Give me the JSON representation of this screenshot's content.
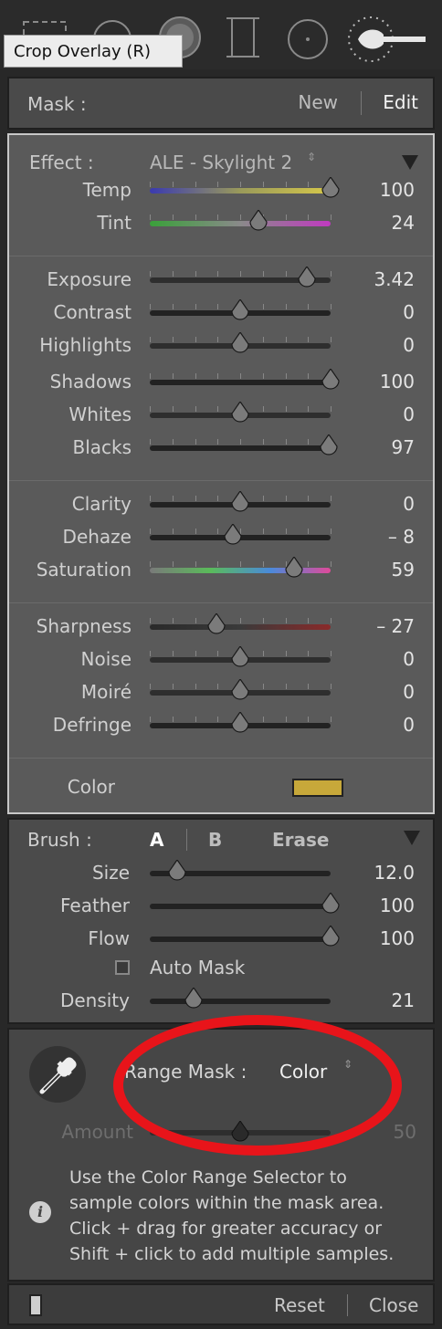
{
  "toolbar": {
    "tools": [
      "crop-overlay-icon",
      "spot-removal-icon",
      "red-eye-icon",
      "graduated-filter-icon",
      "radial-filter-icon",
      "adjustment-brush-icon"
    ],
    "tooltip": "Crop Overlay (R)"
  },
  "mask": {
    "label": "Mask :",
    "new_label": "New",
    "edit_label": "Edit"
  },
  "effect": {
    "label": "Effect :",
    "preset": "ALE - Skylight 2",
    "updown": "⇕"
  },
  "sliders": [
    {
      "label": "Temp",
      "value": "100",
      "pos": 1.0,
      "track": "temp"
    },
    {
      "label": "Tint",
      "value": "24",
      "pos": 0.6,
      "track": "tint"
    },
    {
      "label": "Exposure",
      "value": "3.42",
      "pos": 0.87,
      "track": "gray"
    },
    {
      "label": "Contrast",
      "value": "0",
      "pos": 0.5,
      "track": "dark"
    },
    {
      "label": "Highlights",
      "value": "0",
      "pos": 0.5,
      "track": "gray"
    },
    {
      "label": "Shadows",
      "value": "100",
      "pos": 1.0,
      "track": "dark"
    },
    {
      "label": "Whites",
      "value": "0",
      "pos": 0.5,
      "track": "gray"
    },
    {
      "label": "Blacks",
      "value": "97",
      "pos": 0.99,
      "track": "dark"
    },
    {
      "label": "Clarity",
      "value": "0",
      "pos": 0.5,
      "track": "dark"
    },
    {
      "label": "Dehaze",
      "value": "– 8",
      "pos": 0.46,
      "track": "dark"
    },
    {
      "label": "Saturation",
      "value": "59",
      "pos": 0.8,
      "track": "sat"
    },
    {
      "label": "Sharpness",
      "value": "– 27",
      "pos": 0.37,
      "track": "sharp"
    },
    {
      "label": "Noise",
      "value": "0",
      "pos": 0.5,
      "track": "gray"
    },
    {
      "label": "Moiré",
      "value": "0",
      "pos": 0.5,
      "track": "gray"
    },
    {
      "label": "Defringe",
      "value": "0",
      "pos": 0.5,
      "track": "dark"
    }
  ],
  "color_row": {
    "label": "Color",
    "swatch": "#c7a83a"
  },
  "brush": {
    "label": "Brush :",
    "a_label": "A",
    "b_label": "B",
    "erase_label": "Erase",
    "sliders": [
      {
        "label": "Size",
        "value": "12.0",
        "pos": 0.15
      },
      {
        "label": "Feather",
        "value": "100",
        "pos": 1.0
      },
      {
        "label": "Flow",
        "value": "100",
        "pos": 1.0
      },
      {
        "label": "Density",
        "value": "21",
        "pos": 0.24
      }
    ],
    "auto_mask_label": "Auto Mask"
  },
  "range_mask": {
    "label": "Range Mask :",
    "value": "Color",
    "updown": "⇕",
    "amount_label": "Amount",
    "amount_value": "50",
    "amount_pos": 0.5,
    "info_icon": "i",
    "info_lines": [
      "Use the Color Range Selector to",
      "sample colors within the mask area.",
      "Click + drag for greater accuracy or",
      "Shift + click to add multiple samples."
    ]
  },
  "bottom": {
    "reset_label": "Reset",
    "close_label": "Close"
  },
  "colors": {
    "highlight_ring": "#e8141a",
    "swatch": "#c7a83a"
  }
}
